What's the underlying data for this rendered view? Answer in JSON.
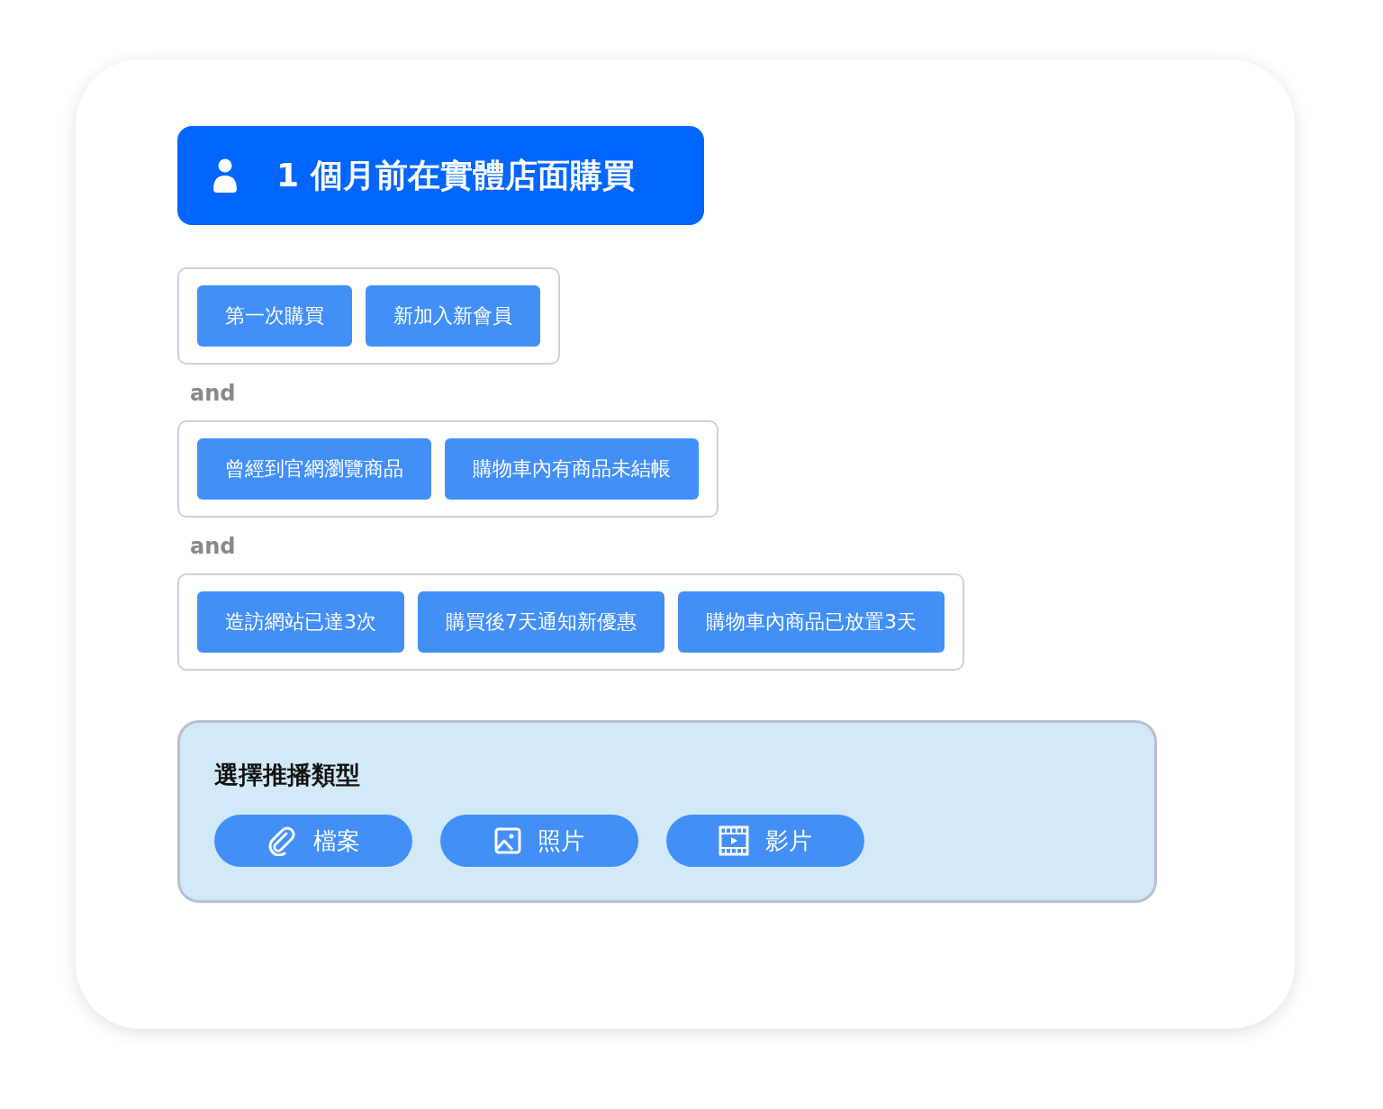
{
  "header": {
    "title": "1 個月前在實體店面購買"
  },
  "condition_groups": [
    {
      "conditions": [
        "第一次購買",
        "新加入新會員"
      ]
    },
    {
      "connector": "and",
      "conditions": [
        "曾經到官網瀏覽商品",
        "購物車內有商品未結帳"
      ]
    },
    {
      "connector": "and",
      "conditions": [
        "造訪網站已達3次",
        "購買後7天通知新優惠",
        "購物車內商品已放置3天"
      ]
    }
  ],
  "push_type": {
    "title": "選擇推播類型",
    "options": [
      {
        "kind": "file",
        "label": "檔案"
      },
      {
        "kind": "photo",
        "label": "照片"
      },
      {
        "kind": "video",
        "label": "影片"
      }
    ]
  }
}
